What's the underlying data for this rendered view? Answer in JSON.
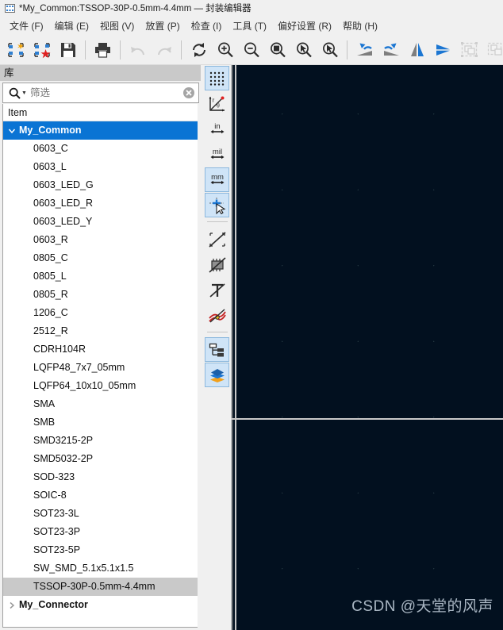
{
  "window": {
    "title": "*My_Common:TSSOP-30P-0.5mm-4.4mm — 封装编辑器",
    "icon": "footprint-editor-icon"
  },
  "menubar": {
    "items": [
      {
        "label": "文件 (F)",
        "name": "menu-file"
      },
      {
        "label": "编辑 (E)",
        "name": "menu-edit"
      },
      {
        "label": "视图 (V)",
        "name": "menu-view"
      },
      {
        "label": "放置 (P)",
        "name": "menu-place"
      },
      {
        "label": "检查 (I)",
        "name": "menu-inspect"
      },
      {
        "label": "工具 (T)",
        "name": "menu-tools"
      },
      {
        "label": "偏好设置 (R)",
        "name": "menu-preferences"
      },
      {
        "label": "帮助 (H)",
        "name": "menu-help"
      }
    ]
  },
  "toolbar": {
    "buttons": [
      {
        "name": "new-footprint-icon",
        "title": "新建封装",
        "disabled": false
      },
      {
        "name": "new-footprint-from-wizard-icon",
        "title": "使用向导创建封装",
        "disabled": false
      },
      {
        "name": "save-icon",
        "title": "保存",
        "disabled": false
      },
      {
        "name": "separator"
      },
      {
        "name": "print-icon",
        "title": "打印",
        "disabled": false
      },
      {
        "name": "separator"
      },
      {
        "name": "undo-icon",
        "title": "撤销",
        "disabled": true
      },
      {
        "name": "redo-icon",
        "title": "重做",
        "disabled": true
      },
      {
        "name": "separator"
      },
      {
        "name": "refresh-icon",
        "title": "刷新",
        "disabled": false
      },
      {
        "name": "zoom-in-icon",
        "title": "放大",
        "disabled": false
      },
      {
        "name": "zoom-out-icon",
        "title": "缩小",
        "disabled": false
      },
      {
        "name": "zoom-fit-icon",
        "title": "缩放到适合页面",
        "disabled": false
      },
      {
        "name": "zoom-to-objects-icon",
        "title": "缩放到对象",
        "disabled": false
      },
      {
        "name": "zoom-selection-icon",
        "title": "缩放到选区",
        "disabled": false
      },
      {
        "name": "separator"
      },
      {
        "name": "rotate-ccw-icon",
        "title": "逆时针旋转",
        "disabled": false
      },
      {
        "name": "rotate-cw-icon",
        "title": "顺时针旋转",
        "disabled": false
      },
      {
        "name": "mirror-horizontal-icon",
        "title": "水平镜像",
        "disabled": false
      },
      {
        "name": "mirror-vertical-icon",
        "title": "垂直镜像",
        "disabled": false
      },
      {
        "name": "group-icon",
        "title": "编组",
        "disabled": true
      },
      {
        "name": "ungroup-icon",
        "title": "取消编组",
        "disabled": true
      }
    ]
  },
  "library_panel": {
    "title": "库",
    "search": {
      "value": "",
      "placeholder": "筛选"
    },
    "tree_header": "Item",
    "tree": [
      {
        "type": "group",
        "label": "My_Common",
        "expanded": true,
        "selected": true
      },
      {
        "type": "leaf",
        "label": "0603_C"
      },
      {
        "type": "leaf",
        "label": "0603_L"
      },
      {
        "type": "leaf",
        "label": "0603_LED_G"
      },
      {
        "type": "leaf",
        "label": "0603_LED_R"
      },
      {
        "type": "leaf",
        "label": "0603_LED_Y"
      },
      {
        "type": "leaf",
        "label": "0603_R"
      },
      {
        "type": "leaf",
        "label": "0805_C"
      },
      {
        "type": "leaf",
        "label": "0805_L"
      },
      {
        "type": "leaf",
        "label": "0805_R"
      },
      {
        "type": "leaf",
        "label": "1206_C"
      },
      {
        "type": "leaf",
        "label": "2512_R"
      },
      {
        "type": "leaf",
        "label": "CDRH104R"
      },
      {
        "type": "leaf",
        "label": "LQFP48_7x7_05mm"
      },
      {
        "type": "leaf",
        "label": "LQFP64_10x10_05mm"
      },
      {
        "type": "leaf",
        "label": "SMA"
      },
      {
        "type": "leaf",
        "label": "SMB"
      },
      {
        "type": "leaf",
        "label": "SMD3215-2P"
      },
      {
        "type": "leaf",
        "label": "SMD5032-2P"
      },
      {
        "type": "leaf",
        "label": "SOD-323"
      },
      {
        "type": "leaf",
        "label": "SOIC-8"
      },
      {
        "type": "leaf",
        "label": "SOT23-3L"
      },
      {
        "type": "leaf",
        "label": "SOT23-3P"
      },
      {
        "type": "leaf",
        "label": "SOT23-5P"
      },
      {
        "type": "leaf",
        "label": "SW_SMD_5.1x5.1x1.5"
      },
      {
        "type": "leaf",
        "label": "TSSOP-30P-0.5mm-4.4mm",
        "highlighted": true
      },
      {
        "type": "group",
        "label": "My_Connector",
        "expanded": false,
        "selected": false
      }
    ]
  },
  "left_toolbar": {
    "buttons": [
      {
        "name": "toggle-grid-icon",
        "title": "显示网格",
        "active": true
      },
      {
        "name": "polar-coordinates-icon",
        "title": "极坐标",
        "active": false
      },
      {
        "name": "units-inches-icon",
        "label": "in",
        "title": "英寸",
        "active": false
      },
      {
        "name": "units-mils-icon",
        "label": "mil",
        "title": "密尔",
        "active": false
      },
      {
        "name": "units-mm-icon",
        "label": "mm",
        "title": "毫米",
        "active": true
      },
      {
        "name": "full-crosshair-cursor-icon",
        "title": "全屏光标",
        "active": true
      },
      {
        "separator": true
      },
      {
        "name": "show-pads-sketch-icon",
        "title": "以草图模式显示焊盘",
        "active": false
      },
      {
        "name": "show-footprint-sketch-icon",
        "title": "以草图模式显示封装",
        "active": false
      },
      {
        "name": "show-text-sketch-icon",
        "title": "以草图模式显示文本",
        "active": false
      },
      {
        "name": "show-graphic-outline-icon",
        "title": "以轮廓模式显示图形",
        "active": false
      },
      {
        "separator2": true
      },
      {
        "name": "footprint-tree-icon",
        "title": "显示封装树",
        "active": true
      },
      {
        "name": "layers-manager-icon",
        "title": "图层管理器",
        "active": true
      }
    ]
  },
  "canvas": {
    "background_color": "#02101f",
    "axis_color": "#c9c9c9",
    "grid_dot_color": "#33484f",
    "watermark": "CSDN @天堂的风声"
  },
  "colors": {
    "accent": "#0a74d4",
    "panel_bg": "#f0f0f0",
    "highlight_row": "#c9c9c9",
    "active_tool": "#cfe4f7"
  }
}
